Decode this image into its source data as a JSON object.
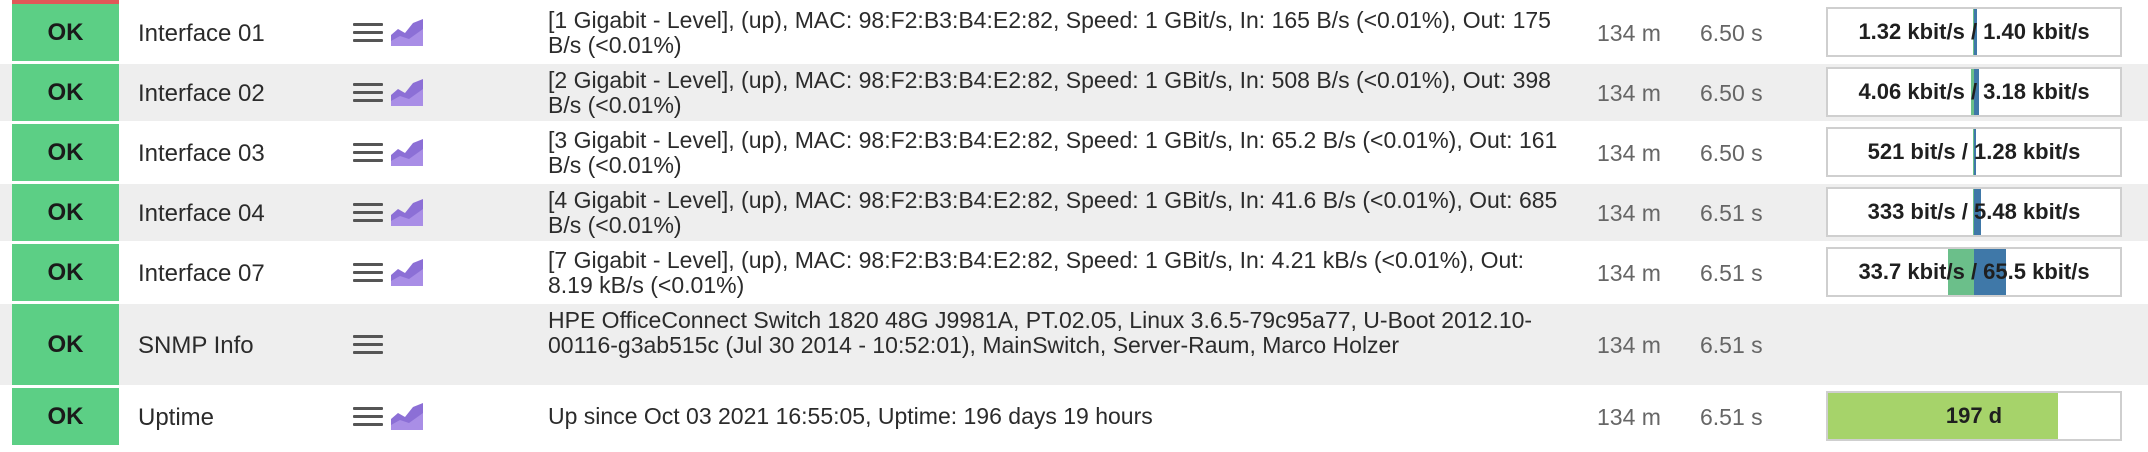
{
  "colors": {
    "ok": "#5ccf85",
    "perf_in": "#6bbf8a",
    "perf_out": "#3f78a8",
    "uptime_fill": "#a6d36a",
    "graph_icon": "#8c6fd6"
  },
  "icons": {
    "menu": "hamburger-menu-icon",
    "graph": "area-graph-icon"
  },
  "services": [
    {
      "state": "OK",
      "name": "Interface 01",
      "summary": "[1 Gigabit - Level], (up), MAC: 98:F2:B3:B4:E2:82, Speed: 1 GBit/s, In: 165 B/s (<0.01%), Out: 175 B/s (<0.01%)",
      "age": "134 m",
      "check": "6.50 s",
      "perf_text": "1.32 kbit/s / 1.40 kbit/s"
    },
    {
      "state": "OK",
      "name": "Interface 02",
      "summary": "[2 Gigabit - Level], (up), MAC: 98:F2:B3:B4:E2:82, Speed: 1 GBit/s, In: 508 B/s (<0.01%), Out: 398 B/s (<0.01%)",
      "age": "134 m",
      "check": "6.50 s",
      "perf_text": "4.06 kbit/s / 3.18 kbit/s"
    },
    {
      "state": "OK",
      "name": "Interface 03",
      "summary": "[3 Gigabit - Level], (up), MAC: 98:F2:B3:B4:E2:82, Speed: 1 GBit/s, In: 65.2 B/s (<0.01%), Out: 161 B/s (<0.01%)",
      "age": "134 m",
      "check": "6.50 s",
      "perf_text": "521 bit/s / 1.28 kbit/s"
    },
    {
      "state": "OK",
      "name": "Interface 04",
      "summary": "[4 Gigabit - Level], (up), MAC: 98:F2:B3:B4:E2:82, Speed: 1 GBit/s, In: 41.6 B/s (<0.01%), Out: 685 B/s (<0.01%)",
      "age": "134 m",
      "check": "6.51 s",
      "perf_text": "333 bit/s / 5.48 kbit/s"
    },
    {
      "state": "OK",
      "name": "Interface 07",
      "summary": "[7 Gigabit - Level], (up), MAC: 98:F2:B3:B4:E2:82, Speed: 1 GBit/s, In: 4.21 kB/s (<0.01%), Out: 8.19 kB/s (<0.01%)",
      "age": "134 m",
      "check": "6.51 s",
      "perf_text": "33.7 kbit/s / 65.5 kbit/s"
    },
    {
      "state": "OK",
      "name": "SNMP Info",
      "summary": "HPE OfficeConnect Switch 1820 48G J9981A, PT.02.05, Linux 3.6.5-79c95a77, U-Boot 2012.10-00116-g3ab515c (Jul 30 2014 - 10:52:01), MainSwitch, Server-Raum, Marco Holzer",
      "age": "134 m",
      "check": "6.51 s"
    },
    {
      "state": "OK",
      "name": "Uptime",
      "summary": "Up since Oct 03 2021 16:55:05, Uptime: 196 days 19 hours",
      "age": "134 m",
      "check": "6.51 s",
      "perf_text": "197 d"
    }
  ]
}
